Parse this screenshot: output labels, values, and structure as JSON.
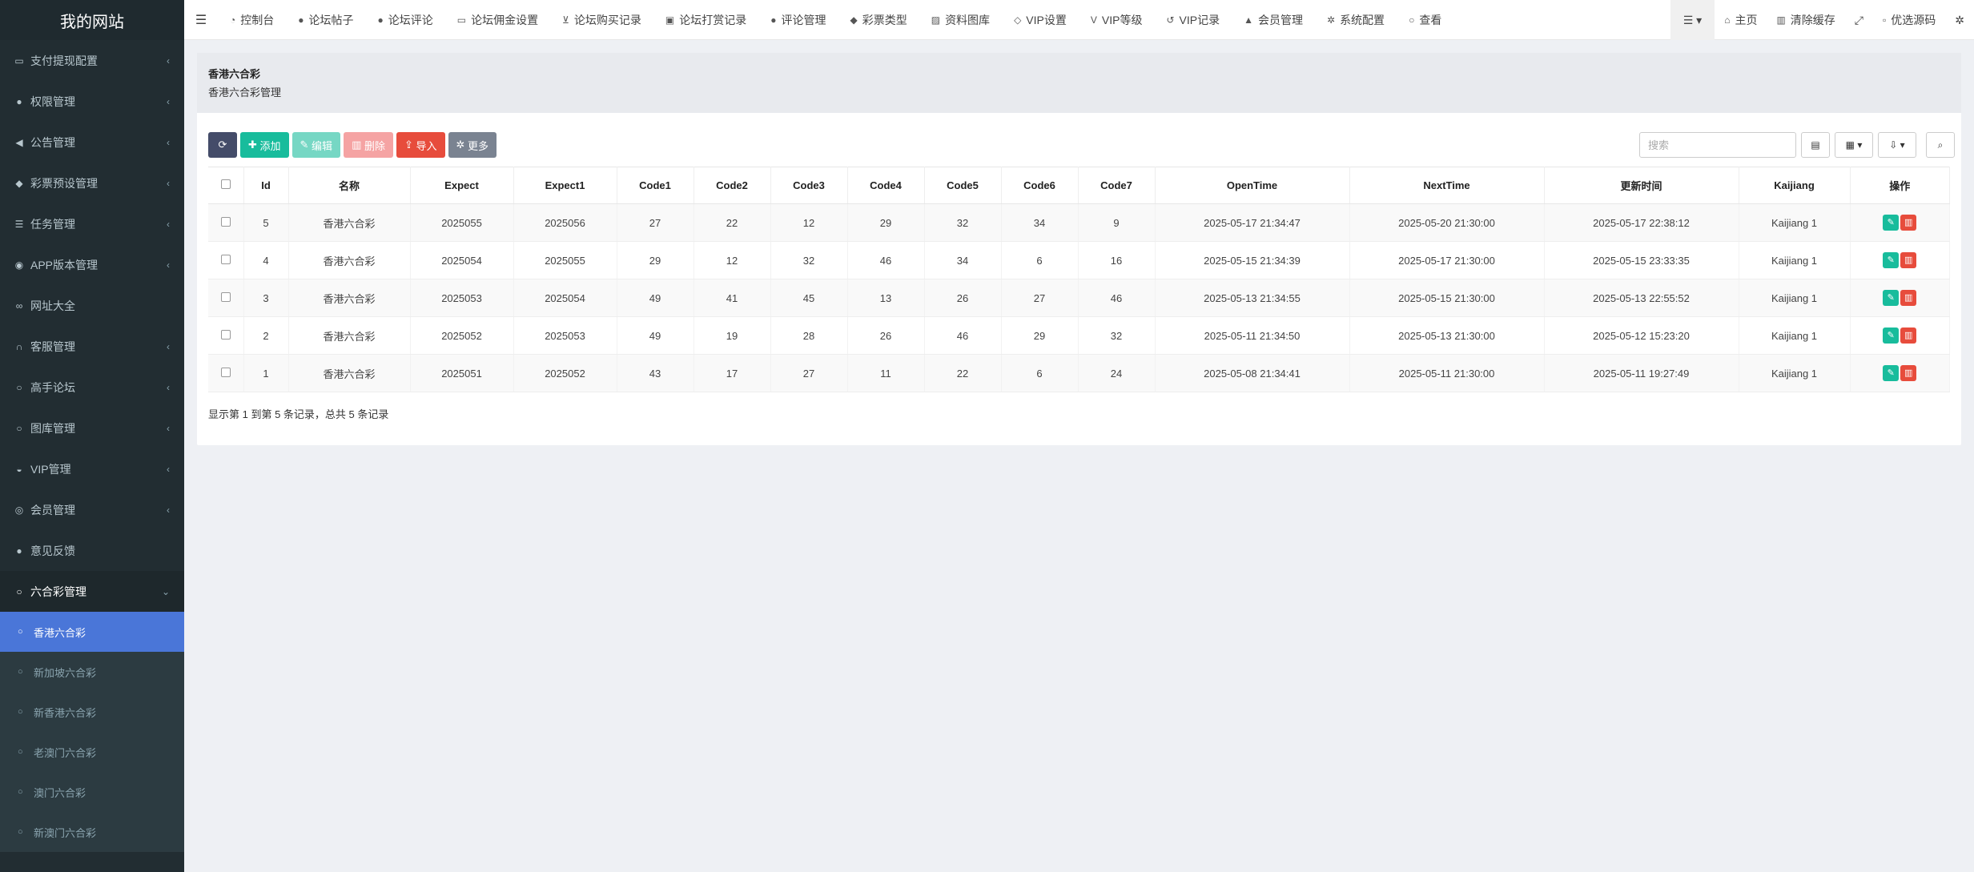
{
  "brand": "我的网站",
  "sidebar": {
    "items": [
      {
        "label": "支付提现配置",
        "icon": "money-icon"
      },
      {
        "label": "权限管理",
        "icon": "users-icon"
      },
      {
        "label": "公告管理",
        "icon": "bullhorn-icon"
      },
      {
        "label": "彩票预设管理",
        "icon": "ticket-icon"
      },
      {
        "label": "任务管理",
        "icon": "list-icon"
      },
      {
        "label": "APP版本管理",
        "icon": "android-icon"
      },
      {
        "label": "网址大全",
        "icon": "link-icon"
      },
      {
        "label": "客服管理",
        "icon": "headset-icon"
      },
      {
        "label": "高手论坛",
        "icon": "circle-icon"
      },
      {
        "label": "图库管理",
        "icon": "circle-icon"
      },
      {
        "label": "VIP管理",
        "icon": "cat-icon"
      },
      {
        "label": "会员管理",
        "icon": "user-circle-icon"
      },
      {
        "label": "意见反馈",
        "icon": "comment-icon"
      },
      {
        "label": "六合彩管理",
        "icon": "circle-icon"
      }
    ],
    "sub_items": [
      {
        "label": "香港六合彩"
      },
      {
        "label": "新加坡六合彩"
      },
      {
        "label": "新香港六合彩"
      },
      {
        "label": "老澳门六合彩"
      },
      {
        "label": "澳门六合彩"
      },
      {
        "label": "新澳门六合彩"
      }
    ]
  },
  "topnav": {
    "links": [
      {
        "label": "控制台",
        "icon": "dashboard-icon"
      },
      {
        "label": "论坛帖子",
        "icon": "comment-icon"
      },
      {
        "label": "论坛评论",
        "icon": "comments-icon"
      },
      {
        "label": "论坛佣金设置",
        "icon": "money-icon"
      },
      {
        "label": "论坛购买记录",
        "icon": "cart-icon"
      },
      {
        "label": "论坛打赏记录",
        "icon": "gift-icon"
      },
      {
        "label": "评论管理",
        "icon": "comments-icon"
      },
      {
        "label": "彩票类型",
        "icon": "ticket-icon"
      },
      {
        "label": "资料图库",
        "icon": "image-icon"
      },
      {
        "label": "VIP设置",
        "icon": "diamond-icon"
      },
      {
        "label": "VIP等级",
        "icon": "vimeo-icon"
      },
      {
        "label": "VIP记录",
        "icon": "history-icon"
      },
      {
        "label": "会员管理",
        "icon": "user-icon"
      },
      {
        "label": "系统配置",
        "icon": "cog-icon"
      },
      {
        "label": "查看",
        "icon": "circle-icon"
      }
    ],
    "home": "主页",
    "clear_cache": "清除缓存",
    "user_name": "优选源码"
  },
  "page": {
    "title": "香港六合彩",
    "subtitle": "香港六合彩管理"
  },
  "toolbar": {
    "add": "添加",
    "edit": "编辑",
    "delete": "删除",
    "import": "导入",
    "more": "更多"
  },
  "search": {
    "placeholder": "搜索"
  },
  "table": {
    "headers": [
      "Id",
      "名称",
      "Expect",
      "Expect1",
      "Code1",
      "Code2",
      "Code3",
      "Code4",
      "Code5",
      "Code6",
      "Code7",
      "OpenTime",
      "NextTime",
      "更新时间",
      "Kaijiang",
      "操作"
    ],
    "rows": [
      {
        "id": "5",
        "name": "香港六合彩",
        "expect": "2025055",
        "expect1": "2025056",
        "code1": "27",
        "code2": "22",
        "code3": "12",
        "code4": "29",
        "code5": "32",
        "code6": "34",
        "code7": "9",
        "open_time": "2025-05-17 21:34:47",
        "next_time": "2025-05-20 21:30:00",
        "updated": "2025-05-17 22:38:12",
        "kaijiang": "Kaijiang 1"
      },
      {
        "id": "4",
        "name": "香港六合彩",
        "expect": "2025054",
        "expect1": "2025055",
        "code1": "29",
        "code2": "12",
        "code3": "32",
        "code4": "46",
        "code5": "34",
        "code6": "6",
        "code7": "16",
        "open_time": "2025-05-15 21:34:39",
        "next_time": "2025-05-17 21:30:00",
        "updated": "2025-05-15 23:33:35",
        "kaijiang": "Kaijiang 1"
      },
      {
        "id": "3",
        "name": "香港六合彩",
        "expect": "2025053",
        "expect1": "2025054",
        "code1": "49",
        "code2": "41",
        "code3": "45",
        "code4": "13",
        "code5": "26",
        "code6": "27",
        "code7": "46",
        "open_time": "2025-05-13 21:34:55",
        "next_time": "2025-05-15 21:30:00",
        "updated": "2025-05-13 22:55:52",
        "kaijiang": "Kaijiang 1"
      },
      {
        "id": "2",
        "name": "香港六合彩",
        "expect": "2025052",
        "expect1": "2025053",
        "code1": "49",
        "code2": "19",
        "code3": "28",
        "code4": "26",
        "code5": "46",
        "code6": "29",
        "code7": "32",
        "open_time": "2025-05-11 21:34:50",
        "next_time": "2025-05-13 21:30:00",
        "updated": "2025-05-12 15:23:20",
        "kaijiang": "Kaijiang 1"
      },
      {
        "id": "1",
        "name": "香港六合彩",
        "expect": "2025051",
        "expect1": "2025052",
        "code1": "43",
        "code2": "17",
        "code3": "27",
        "code4": "11",
        "code5": "22",
        "code6": "6",
        "code7": "24",
        "open_time": "2025-05-08 21:34:41",
        "next_time": "2025-05-11 21:30:00",
        "updated": "2025-05-11 19:27:49",
        "kaijiang": "Kaijiang 1"
      }
    ],
    "summary": "显示第 1 到第 5 条记录，总共 5 条记录"
  },
  "colors": {
    "sidebar_bg": "#222d32",
    "active_blue": "#4a76d8",
    "success": "#18bc9c",
    "danger": "#e74c3c"
  }
}
